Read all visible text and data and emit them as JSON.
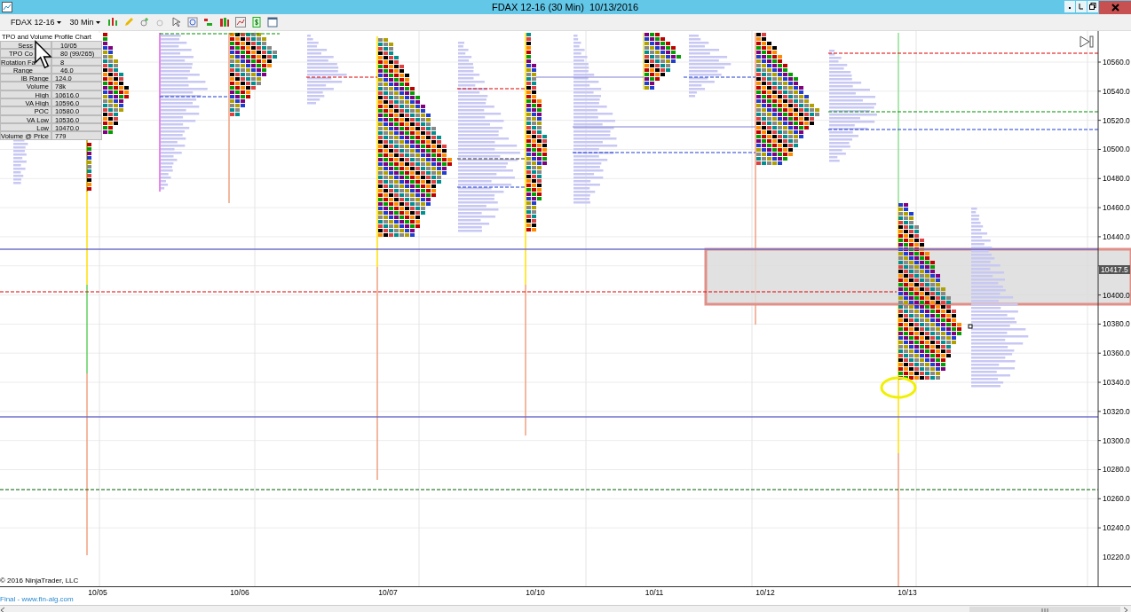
{
  "window": {
    "title": "FDAX 12-16 (30 Min)  10/13/2016"
  },
  "toolbar": {
    "instrument": "FDAX 12-16",
    "interval": "30 Min"
  },
  "chart": {
    "title": "TPO and Volume Profile Chart",
    "info_rows": [
      {
        "label": "Sess",
        "value": "10/05"
      },
      {
        "label": "TPO Co",
        "value": "80 (99/265)"
      },
      {
        "label": "Rotation Fa",
        "value": "8"
      },
      {
        "label": "Range",
        "value": "46.0"
      },
      {
        "label": "IB Range",
        "value": "124.0"
      },
      {
        "label": "Volume",
        "value": "78k"
      },
      {
        "label": "High",
        "value": "10616.0"
      },
      {
        "label": "VA High",
        "value": "10596.0"
      },
      {
        "label": "POC",
        "value": "10580.0"
      },
      {
        "label": "VA Low",
        "value": "10536.0"
      },
      {
        "label": "Low",
        "value": "10470.0"
      },
      {
        "label": "Volume @ Price",
        "value": "779"
      }
    ],
    "price_marker": "10417.5",
    "y_labels": [
      "10560.0",
      "10540.0",
      "10520.0",
      "10500.0",
      "10480.0",
      "10460.0",
      "10440.0",
      "10400.0",
      "10380.0",
      "10360.0",
      "10340.0",
      "10320.0",
      "10300.0",
      "10280.0",
      "10260.0",
      "10240.0",
      "10220.0"
    ],
    "x_labels": [
      "10/05",
      "10/06",
      "10/07",
      "10/10",
      "10/11",
      "10/12",
      "10/13"
    ],
    "copyright": "© 2016 NinjaTrader, LLC",
    "footer_link": "Final - www.fin-alg.com"
  }
}
